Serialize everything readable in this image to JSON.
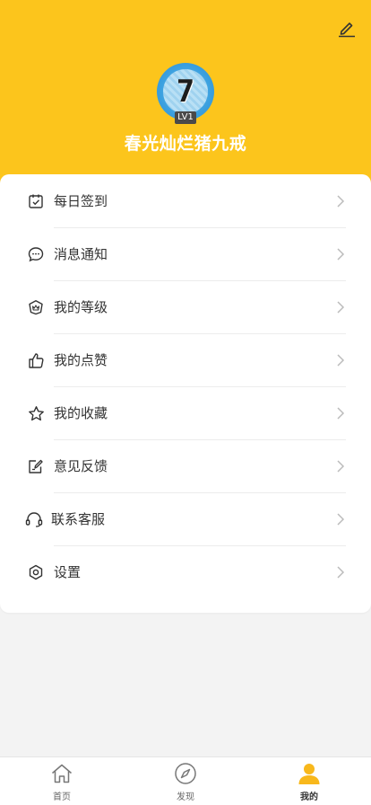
{
  "profile": {
    "avatar_text": "7",
    "level": "LV1",
    "username": "春光灿烂猪九戒"
  },
  "menu": {
    "items": [
      {
        "label": "每日签到",
        "icon": "calendar-check-icon"
      },
      {
        "label": "消息通知",
        "icon": "chat-bubble-icon"
      },
      {
        "label": "我的等级",
        "icon": "crown-shield-icon"
      },
      {
        "label": "我的点赞",
        "icon": "thumbs-up-icon"
      },
      {
        "label": "我的收藏",
        "icon": "star-icon"
      },
      {
        "label": "意见反馈",
        "icon": "feedback-edit-icon"
      },
      {
        "label": "联系客服",
        "icon": "headset-icon"
      },
      {
        "label": "设置",
        "icon": "gear-icon"
      }
    ]
  },
  "tabbar": {
    "tabs": [
      {
        "label": "首页",
        "icon": "home-icon"
      },
      {
        "label": "发现",
        "icon": "compass-icon"
      },
      {
        "label": "我的",
        "icon": "person-icon"
      }
    ],
    "active": "我的"
  },
  "colors": {
    "brand": "#fcc51c",
    "active_icon": "#f8b81c"
  }
}
